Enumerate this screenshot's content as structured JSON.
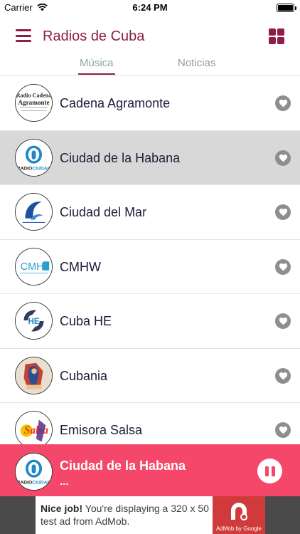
{
  "status_bar": {
    "carrier": "Carrier",
    "time": "6:24 PM",
    "battery_level": 1.0
  },
  "header": {
    "title": "Radios de Cuba",
    "menu_icon": "hamburger-menu-icon",
    "grid_icon": "grid-view-icon"
  },
  "tabs": [
    {
      "label": "Música",
      "active": true
    },
    {
      "label": "Noticias",
      "active": false
    }
  ],
  "stations": [
    {
      "name": "Cadena Agramonte",
      "logo": "Radio Cadena Agramonte",
      "selected": false
    },
    {
      "name": "Ciudad de la Habana",
      "logo": "RADIO CIUDAD",
      "selected": true
    },
    {
      "name": "Ciudad del Mar",
      "logo": "",
      "selected": false
    },
    {
      "name": "CMHW",
      "logo": "CMHW",
      "selected": false
    },
    {
      "name": "Cuba HE",
      "logo": "HE",
      "selected": false
    },
    {
      "name": "Cubania",
      "logo": "",
      "selected": false
    },
    {
      "name": "Emisora Salsa",
      "logo": "Salsa",
      "selected": false
    }
  ],
  "now_playing": {
    "title": "Ciudad de la Habana",
    "subtitle": "...",
    "logo": "RADIO CIUDAD"
  },
  "ad": {
    "headline": "Nice job!",
    "body": "You're displaying a 320 x 50 test ad from AdMob.",
    "brand": "AdMob by Google"
  },
  "colors": {
    "accent": "#8e1d4a",
    "player_bg": "#f5476a",
    "selected_row": "#d8d8d8"
  }
}
